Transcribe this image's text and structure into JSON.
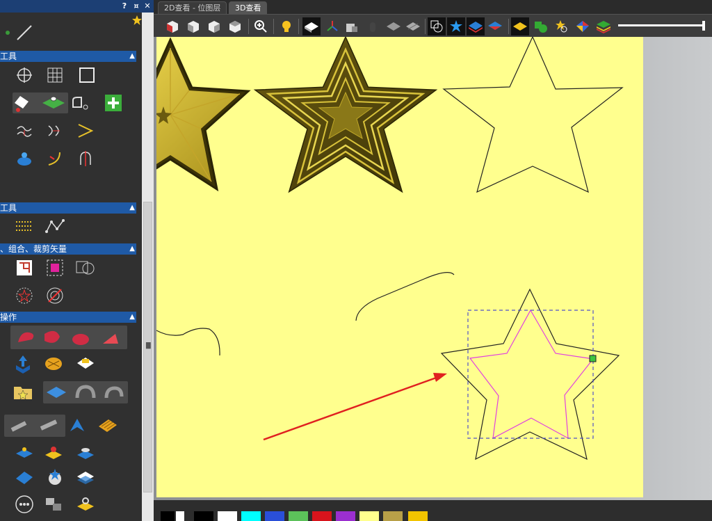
{
  "panel": {
    "sections": [
      {
        "label": "工具",
        "chevron": "▲"
      },
      {
        "label": "工具",
        "chevron": "▲"
      },
      {
        "label": "、组合、裁剪矢量",
        "chevron": "▲"
      },
      {
        "label": "操作",
        "chevron": "▲"
      }
    ],
    "header_buttons": [
      "?",
      "¤",
      "✕"
    ]
  },
  "tabs": [
    {
      "label": "2D查看 - 位图层",
      "active": false
    },
    {
      "label": "3D查看",
      "active": true
    }
  ],
  "toolbar": {
    "icons": [
      "cube-front-icon",
      "cube-left-icon",
      "cube-right-icon",
      "cube-top-icon",
      "zoom-icon",
      "light-bulb-icon",
      "material-plane-icon",
      "axes-icon",
      "shape-icon",
      "cylinder-icon",
      "relief-gray-icon",
      "relief-split-icon",
      "vector-toggle-icon",
      "star-blue-icon",
      "layers-icon",
      "layers-red-icon",
      "composite-icon",
      "shapes-icon",
      "star-zoom-icon",
      "color-cube-icon",
      "stack-icon"
    ]
  },
  "palette": {
    "colors": [
      "#000000",
      "#ffffff",
      "#000000",
      "#ffffff",
      "#00ffff",
      "#2a4fd8",
      "#5cc15a",
      "#d8141c",
      "#9b2fd0",
      "#ffff8e",
      "#b8a048",
      "#f2c400"
    ]
  },
  "canvas": {
    "background": "#ffff8e"
  }
}
